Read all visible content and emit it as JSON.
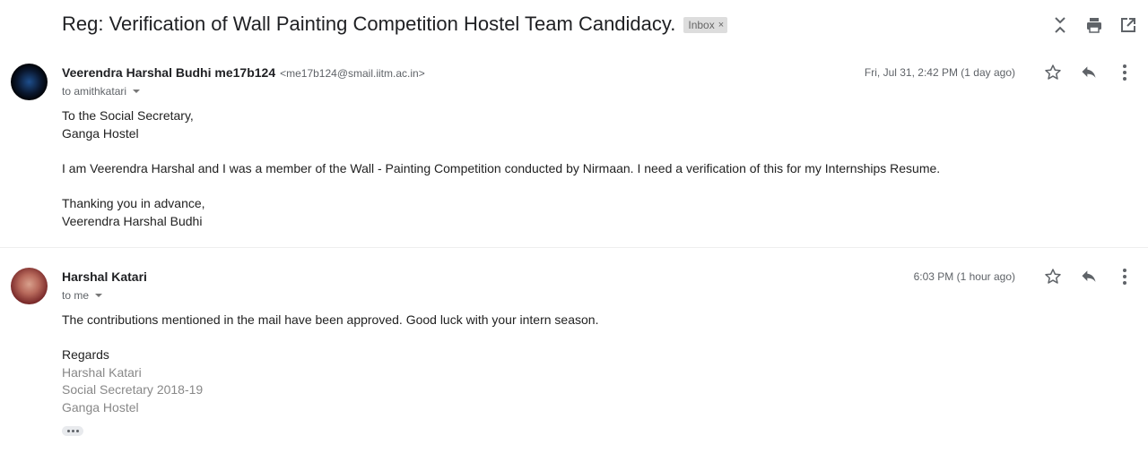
{
  "thread": {
    "subject": "Reg: Verification of Wall Painting Competition Hostel Team Candidacy.",
    "label": "Inbox",
    "label_remove": "×"
  },
  "toolbar_icons": [
    "expand-collapse-icon",
    "print-icon",
    "open-in-new-window-icon"
  ],
  "messages": [
    {
      "sender_name": "Veerendra Harshal Budhi me17b124",
      "sender_email": "<me17b124@smail.iitm.ac.in>",
      "to": "to amithkatari",
      "date": "Fri, Jul 31, 2:42 PM (1 day ago)",
      "body": [
        "To the Social Secretary,",
        "Ganga Hostel",
        "",
        "I am Veerendra Harshal and I was a member of the Wall - Painting Competition conducted by Nirmaan. I need a verification of this for my Internships Resume.",
        "",
        "Thanking you in advance,",
        "Veerendra Harshal Budhi"
      ]
    },
    {
      "sender_name": "Harshal Katari",
      "to": "to me",
      "date": "6:03 PM (1 hour ago)",
      "body": [
        "The contributions mentioned in the mail have been approved. Good luck with your intern season.",
        "",
        "Regards"
      ],
      "signature": [
        "Harshal Katari",
        "Social Secretary 2018-19",
        "Ganga Hostel"
      ]
    }
  ],
  "colors": {
    "label_bg": "#dddddd",
    "icon": "#5f6368",
    "signature_text": "#888888"
  }
}
